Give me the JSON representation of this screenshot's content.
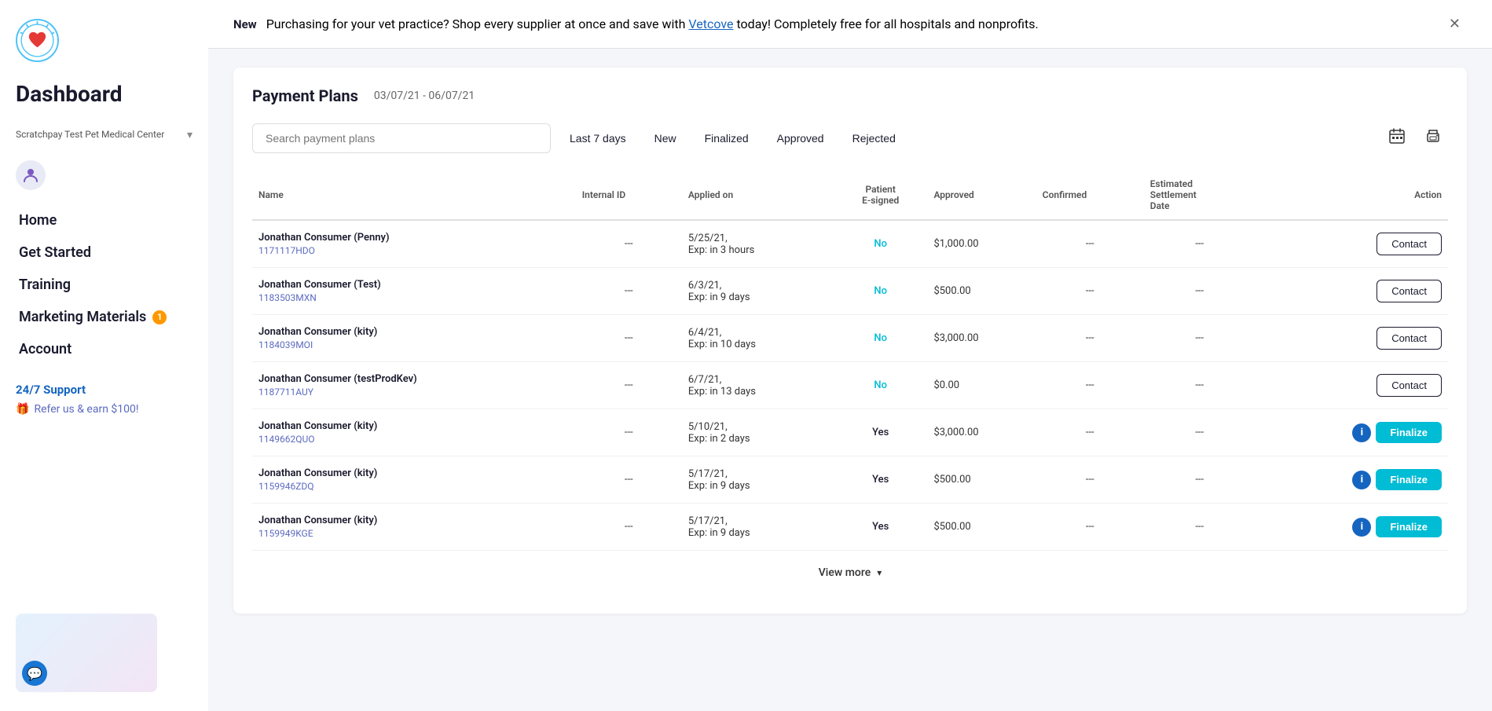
{
  "sidebar": {
    "title": "Dashboard",
    "org": {
      "name": "Scratchpay Test Pet Medical Center"
    },
    "nav": [
      {
        "label": "Home",
        "id": "home",
        "badge": null
      },
      {
        "label": "Get Started",
        "id": "get-started",
        "badge": null
      },
      {
        "label": "Training",
        "id": "training",
        "badge": null
      },
      {
        "label": "Marketing Materials",
        "id": "marketing-materials",
        "badge": "1"
      },
      {
        "label": "Account",
        "id": "account",
        "badge": null
      }
    ],
    "support": "24/7 Support",
    "refer": "Refer us & earn $100!"
  },
  "banner": {
    "new_label": "New",
    "text": "Purchasing for your vet practice? Shop every supplier at once and save with",
    "link_text": "Vetcove",
    "text_after": "today! Completely free for all hospitals and nonprofits."
  },
  "payment_plans": {
    "title": "Payment Plans",
    "date_range": "03/07/21 - 06/07/21",
    "search_placeholder": "Search payment plans",
    "filters": [
      {
        "label": "Last 7 days",
        "id": "last7"
      },
      {
        "label": "New",
        "id": "new"
      },
      {
        "label": "Finalized",
        "id": "finalized"
      },
      {
        "label": "Approved",
        "id": "approved"
      },
      {
        "label": "Rejected",
        "id": "rejected"
      }
    ],
    "columns": [
      {
        "key": "name",
        "label": "Name"
      },
      {
        "key": "internal_id",
        "label": "Internal ID"
      },
      {
        "key": "applied_on",
        "label": "Applied on"
      },
      {
        "key": "patient_esigned",
        "label": "Patient\nE-signed"
      },
      {
        "key": "approved",
        "label": "Approved"
      },
      {
        "key": "confirmed",
        "label": "Confirmed"
      },
      {
        "key": "estimated_settlement_date",
        "label": "Estimated Settlement Date"
      },
      {
        "key": "action",
        "label": "Action"
      }
    ],
    "rows": [
      {
        "name": "Jonathan Consumer (Penny)",
        "id": "1171117HDO",
        "internal_id": "---",
        "applied_on": "5/25/21,",
        "applied_on2": "Exp: in 3 hours",
        "patient_esigned": "No",
        "esigned_class": "no",
        "approved": "$1,000.00",
        "confirmed": "---",
        "estimated_settlement_date": "---",
        "action_type": "contact"
      },
      {
        "name": "Jonathan Consumer (Test)",
        "id": "1183503MXN",
        "internal_id": "---",
        "applied_on": "6/3/21,",
        "applied_on2": "Exp: in 9 days",
        "patient_esigned": "No",
        "esigned_class": "no",
        "approved": "$500.00",
        "confirmed": "---",
        "estimated_settlement_date": "---",
        "action_type": "contact"
      },
      {
        "name": "Jonathan Consumer (kity)",
        "id": "1184039MOI",
        "internal_id": "---",
        "applied_on": "6/4/21,",
        "applied_on2": "Exp: in 10 days",
        "patient_esigned": "No",
        "esigned_class": "no",
        "approved": "$3,000.00",
        "confirmed": "---",
        "estimated_settlement_date": "---",
        "action_type": "contact"
      },
      {
        "name": "Jonathan Consumer (testProdKev)",
        "id": "1187711AUY",
        "internal_id": "---",
        "applied_on": "6/7/21,",
        "applied_on2": "Exp: in 13 days",
        "patient_esigned": "No",
        "esigned_class": "no",
        "approved": "$0.00",
        "confirmed": "---",
        "estimated_settlement_date": "---",
        "action_type": "contact"
      },
      {
        "name": "Jonathan Consumer (kity)",
        "id": "1149662QUO",
        "internal_id": "---",
        "applied_on": "5/10/21,",
        "applied_on2": "Exp: in 2 days",
        "patient_esigned": "Yes",
        "esigned_class": "yes",
        "approved": "$3,000.00",
        "confirmed": "---",
        "estimated_settlement_date": "---",
        "action_type": "finalize"
      },
      {
        "name": "Jonathan Consumer (kity)",
        "id": "1159946ZDQ",
        "internal_id": "---",
        "applied_on": "5/17/21,",
        "applied_on2": "Exp: in 9 days",
        "patient_esigned": "Yes",
        "esigned_class": "yes",
        "approved": "$500.00",
        "confirmed": "---",
        "estimated_settlement_date": "---",
        "action_type": "finalize"
      },
      {
        "name": "Jonathan Consumer (kity)",
        "id": "1159949KGE",
        "internal_id": "---",
        "applied_on": "5/17/21,",
        "applied_on2": "Exp: in 9 days",
        "patient_esigned": "Yes",
        "esigned_class": "yes",
        "approved": "$500.00",
        "confirmed": "---",
        "estimated_settlement_date": "---",
        "action_type": "finalize"
      }
    ],
    "view_more_label": "View more",
    "contact_btn_label": "Contact",
    "finalize_btn_label": "Finalize"
  }
}
